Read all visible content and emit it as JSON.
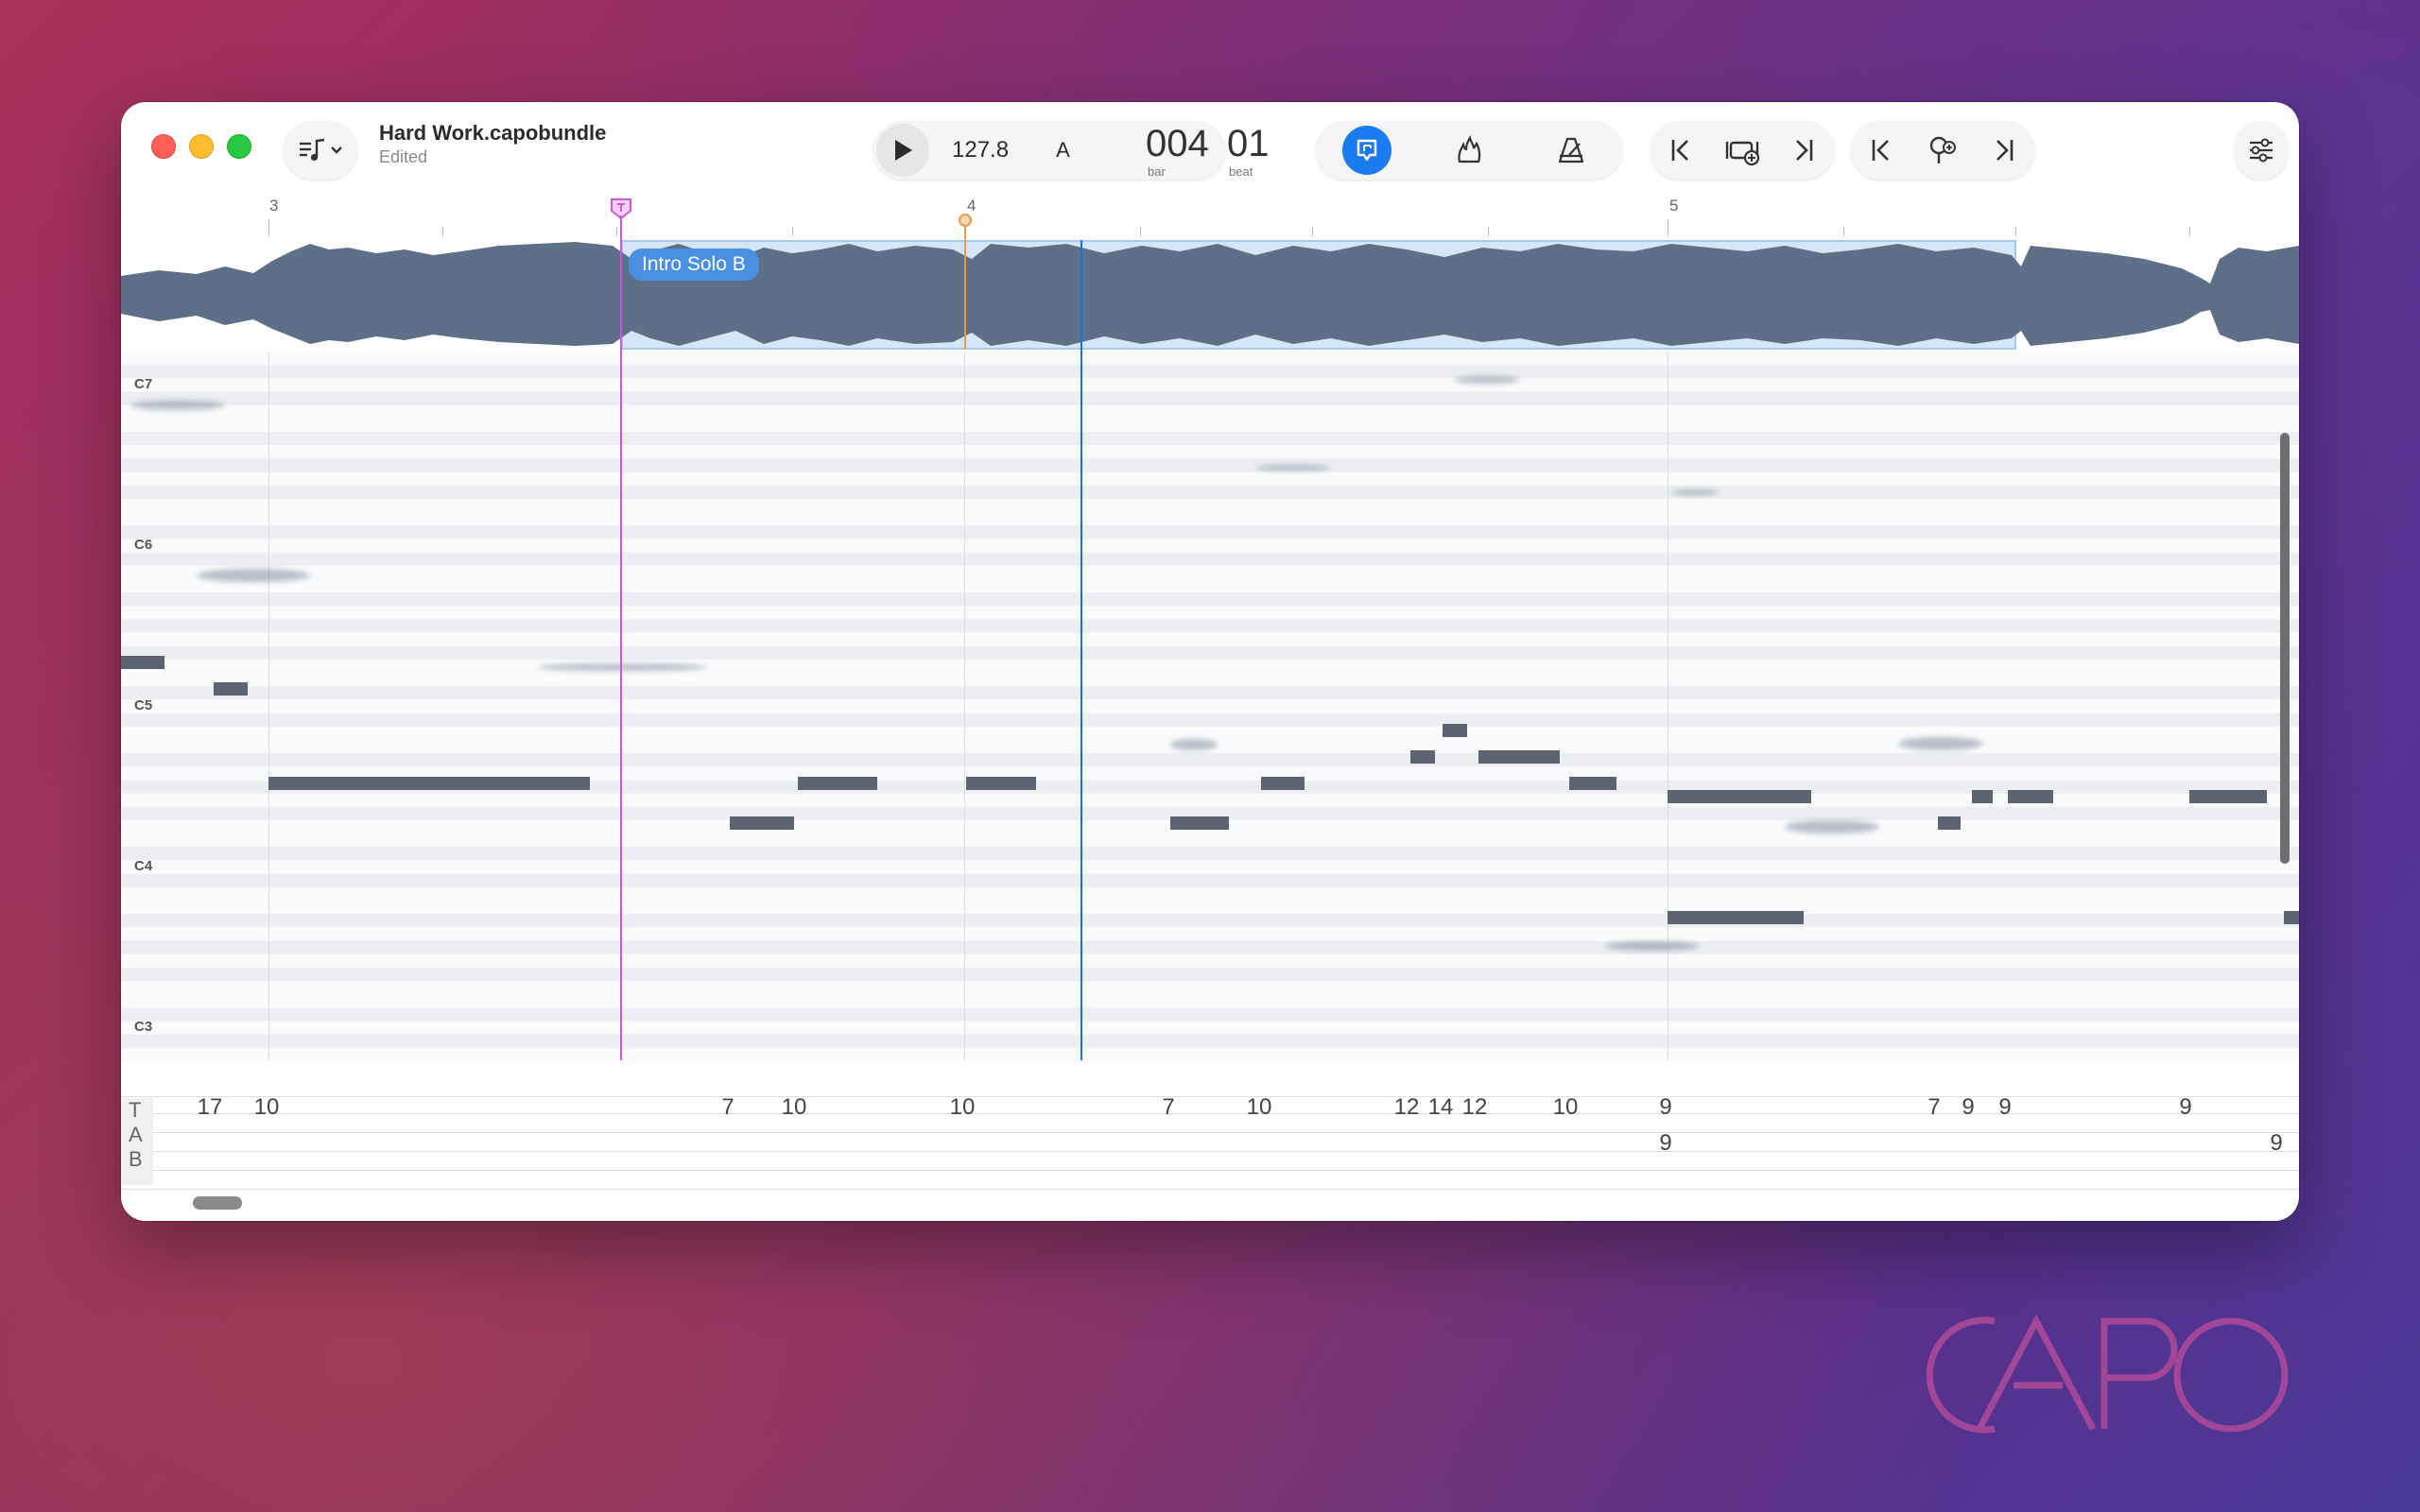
{
  "window": {
    "document_title": "Hard Work.capobundle",
    "document_status": "Edited"
  },
  "transport": {
    "tempo": "127.8",
    "key_mode": "A",
    "bar_value": "004",
    "bar_label": "bar",
    "beat_value": "01",
    "beat_label": "beat"
  },
  "ruler": {
    "bars": [
      "3",
      "4",
      "5"
    ]
  },
  "region": {
    "label": "Intro Solo B"
  },
  "piano_roll": {
    "pitch_labels": [
      "C7",
      "C6",
      "C5",
      "C4",
      "C3"
    ]
  },
  "tab": {
    "string_labels": [
      "T",
      "A",
      "B"
    ],
    "upper_row": [
      "17",
      "10",
      "7",
      "10",
      "10",
      "7",
      "10",
      "12",
      "14",
      "12",
      "10",
      "9",
      "7",
      "9",
      "9",
      "9"
    ],
    "lower_row": [
      "9",
      "9"
    ]
  },
  "branding": {
    "watermark": "CAPO"
  },
  "colors": {
    "accent": "#4a90e2",
    "loop_marker": "#c95ad6",
    "playhead_marker": "#e89a4a",
    "note": "#5b6470"
  },
  "icons": [
    "song-menu-icon",
    "play-icon",
    "note-tracking-icon",
    "fire-icon",
    "metronome-icon",
    "jump-start-icon",
    "add-marker-icon",
    "jump-end-icon",
    "previous-marker-icon",
    "marker-tag-icon",
    "next-marker-icon",
    "settings-sliders-icon"
  ]
}
